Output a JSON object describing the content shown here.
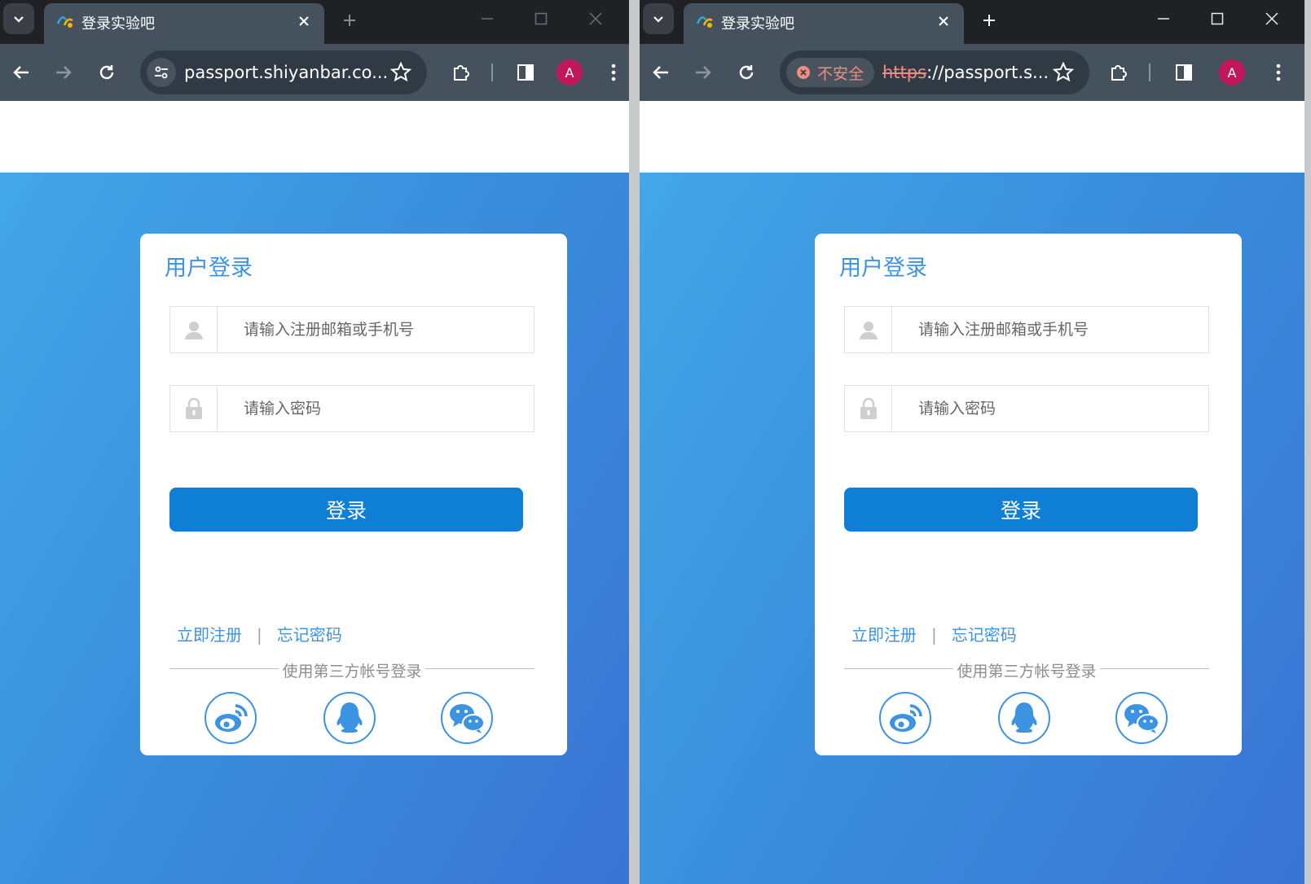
{
  "browsers": [
    {
      "tab_title": "登录实验吧",
      "url": "passport.shiyanbar.co...",
      "security_label": "",
      "avatar_letter": "A"
    },
    {
      "tab_title": "登录实验吧",
      "url_scheme": "https",
      "url_rest": "://passport.s...",
      "security_label": "不安全",
      "avatar_letter": "A"
    }
  ],
  "login": {
    "title": "用户登录",
    "username_placeholder": "请输入注册邮箱或手机号",
    "password_placeholder": "请输入密码",
    "submit_label": "登录",
    "register_link": "立即注册",
    "separator": "|",
    "forgot_link": "忘记密码",
    "third_party_label": "使用第三方帐号登录",
    "social": [
      "weibo-icon",
      "qq-icon",
      "wechat-icon"
    ]
  },
  "colors": {
    "accent": "#3b93e2",
    "button": "#0e7fd5",
    "gradient_start": "#43a7e8",
    "gradient_end": "#3a74d4",
    "insecure": "#f28b82",
    "avatar": "#c2185b"
  }
}
